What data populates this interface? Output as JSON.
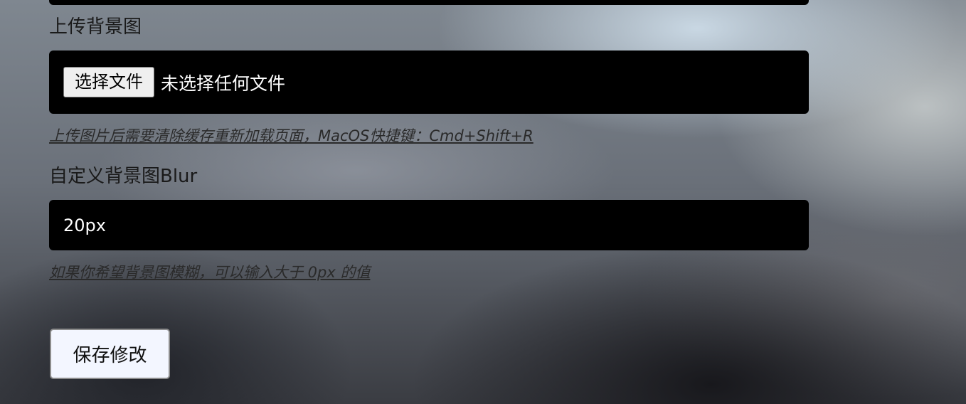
{
  "background_upload": {
    "label": "上传背景图",
    "choose_button": "选择文件",
    "file_status": "未选择任何文件",
    "hint": "上传图片后需要清除缓存重新加载页面，MacOS快捷键：Cmd+Shift+R"
  },
  "background_blur": {
    "label": "自定义背景图Blur",
    "value": "20px",
    "hint": "如果你希望背景图模糊，可以输入大于 0px 的值"
  },
  "actions": {
    "save_label": "保存修改"
  },
  "colors": {
    "field_background": "#000000",
    "field_text": "#ffffff",
    "save_button_background": "#f3f6ff"
  }
}
